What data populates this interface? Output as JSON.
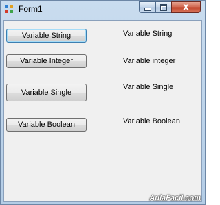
{
  "window": {
    "title": "Form1",
    "icon": "windows-forms-app-icon",
    "caption_buttons": {
      "minimize": "minimize-icon",
      "maximize": "maximize-icon",
      "close": "x"
    }
  },
  "buttons": [
    {
      "label": "Variable String",
      "focused": true
    },
    {
      "label": "Variable Integer",
      "focused": false
    },
    {
      "label": "Variable Single",
      "focused": false
    },
    {
      "label": "Variable Boolean",
      "focused": false
    }
  ],
  "labels": [
    "Variable String",
    "Variable integer",
    "Variable Single",
    "Variable Boolean"
  ],
  "watermark": "AulaFacil.com",
  "colors": {
    "close_button": "#c0432a",
    "focus_border": "#3c7fb1"
  }
}
